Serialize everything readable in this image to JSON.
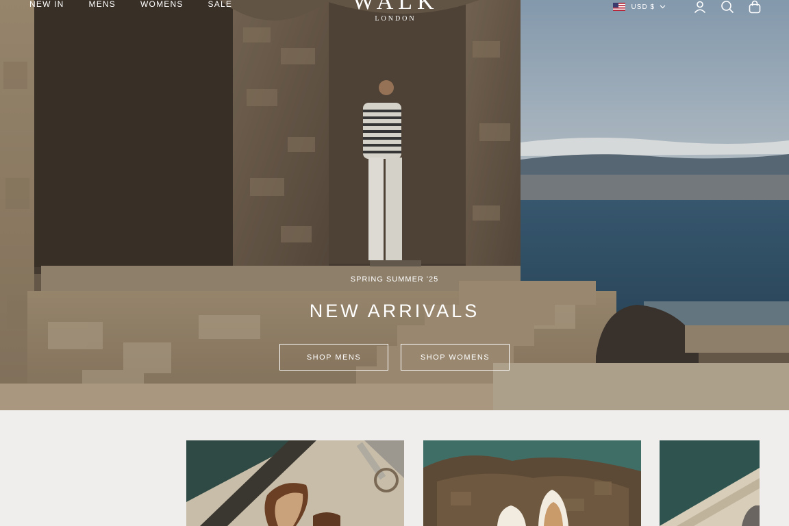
{
  "nav": {
    "links": [
      "NEW IN",
      "MENS",
      "WOMENS",
      "SALE"
    ],
    "logo": {
      "word": "WALK",
      "sub": "LONDON"
    },
    "currency": "USD $"
  },
  "hero": {
    "eyebrow": "SPRING SUMMER '25",
    "headline": "NEW ARRIVALS",
    "buttons": [
      "SHOP MENS",
      "SHOP WOMENS"
    ]
  },
  "icons": [
    "us-flag-icon",
    "chevron-down-icon",
    "account-icon",
    "search-icon",
    "cart-icon"
  ],
  "colors": {
    "background": "#efeeec",
    "text_on_image": "#ffffff"
  }
}
